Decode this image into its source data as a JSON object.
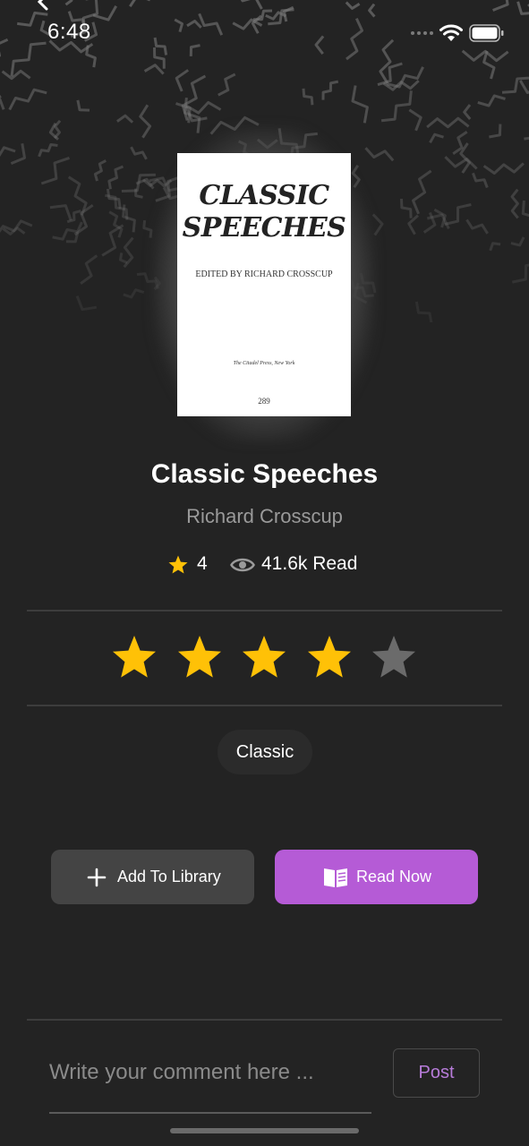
{
  "status_bar": {
    "time": "6:48"
  },
  "book": {
    "cover": {
      "title": "CLASSIC\nSPEECHES",
      "editor": "EDITED BY RICHARD CROSSCUP",
      "press": "The Citadel Press, New York",
      "number": "289"
    },
    "title": "Classic Speeches",
    "author": "Richard Crosscup",
    "rating": "4",
    "reads": "41.6k Read",
    "genre": "Classic"
  },
  "user_rating": {
    "value": 4,
    "max": 5,
    "filled_color": "#ffc107",
    "empty_color": "#6b6b6b"
  },
  "actions": {
    "add_to_library_label": "Add To Library",
    "read_now_label": "Read Now",
    "accent_color": "#b55bd6"
  },
  "comment": {
    "placeholder": "Write your comment here ...",
    "value": "",
    "post_label": "Post"
  },
  "icons": {
    "back": "chevron-left-icon",
    "wifi": "wifi-icon",
    "battery": "battery-icon",
    "rating": "star-icon",
    "reads": "eye-icon",
    "add": "plus-icon",
    "read": "open-book-icon"
  }
}
